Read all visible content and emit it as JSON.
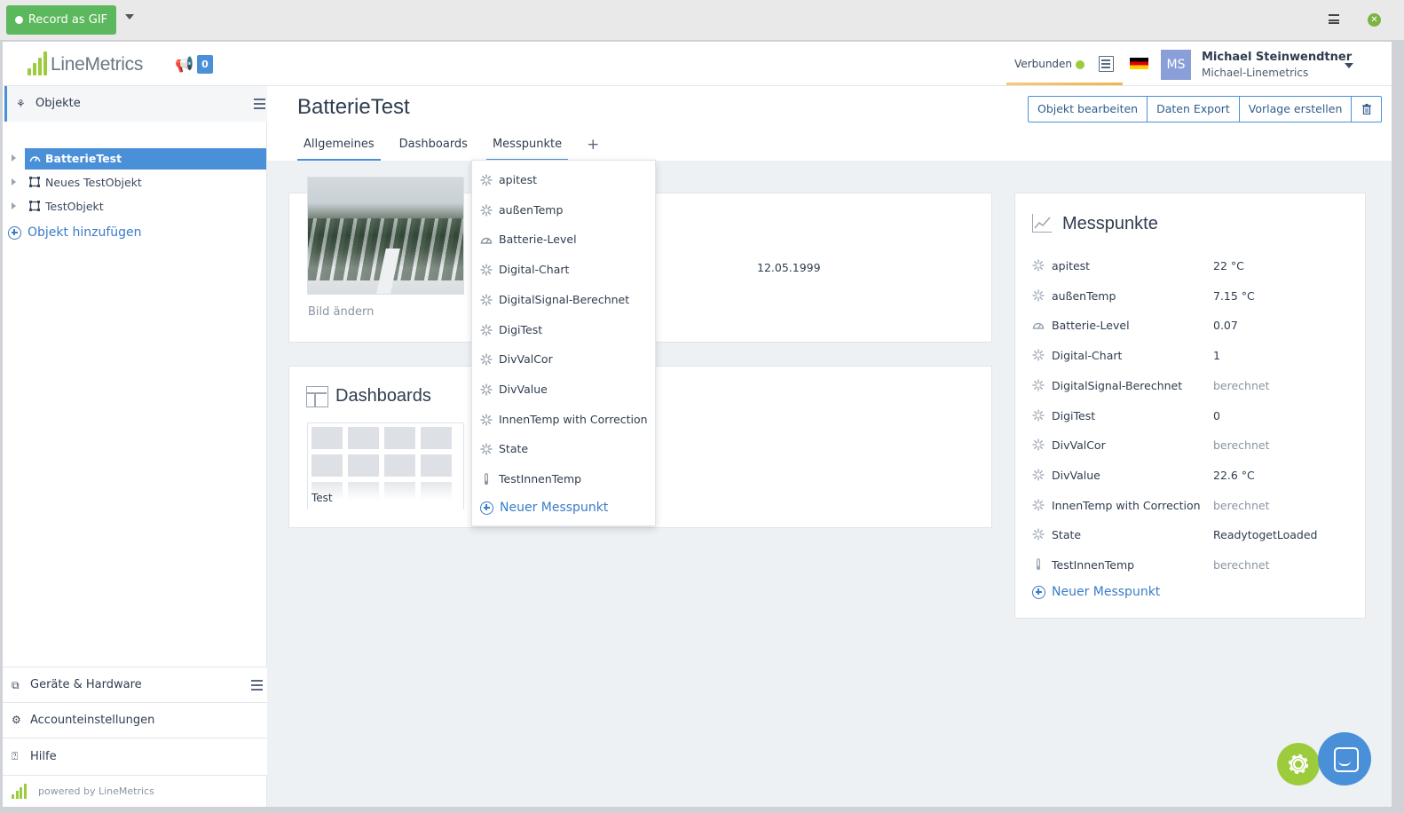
{
  "extension": {
    "record_label": "Record as GIF"
  },
  "header": {
    "logo_text": "LineMetrics",
    "notification_count": "0",
    "connection_status": "Verbunden",
    "connection_color": "#9ccc3c",
    "user_initials": "MS",
    "user_name": "Michael Steinwendtner",
    "user_org": "Michael-Linemetrics"
  },
  "sidebar": {
    "section_title": "Objekte",
    "tree": [
      {
        "label": "BatterieTest",
        "active": true,
        "icon": "gauge-icon"
      },
      {
        "label": "Neues TestObjekt",
        "active": false,
        "icon": "object-icon"
      },
      {
        "label": "TestObjekt",
        "active": false,
        "icon": "object-icon"
      }
    ],
    "add_object": "Objekt hinzufügen",
    "bottom": [
      {
        "label": "Geräte & Hardware",
        "icon": "devices-icon"
      },
      {
        "label": "Accounteinstellungen",
        "icon": "gear-icon"
      },
      {
        "label": "Hilfe",
        "icon": "help-icon"
      }
    ],
    "powered_by": "powered by LineMetrics"
  },
  "object": {
    "title": "BatterieTest",
    "tabs": [
      "Allgemeines",
      "Dashboards",
      "Messpunkte",
      "+"
    ],
    "active_tab": "Messpunkte",
    "actions": [
      "Objekt bearbeiten",
      "Daten Export",
      "Vorlage erstellen"
    ],
    "image_action": "Bild ändern",
    "date": "12.05.1999"
  },
  "dashboards": {
    "title": "Dashboards",
    "items": [
      {
        "label": "Test"
      }
    ]
  },
  "messpunkte": {
    "title": "Messpunkte",
    "items": [
      {
        "name": "apitest",
        "value": "22 °C",
        "muted": false,
        "icon": "spinner-icon"
      },
      {
        "name": "außenTemp",
        "value": "7.15 °C",
        "muted": false,
        "icon": "spinner-icon"
      },
      {
        "name": "Batterie-Level",
        "value": "0.07",
        "muted": false,
        "icon": "gauge-icon"
      },
      {
        "name": "Digital-Chart",
        "value": "1",
        "muted": false,
        "icon": "spinner-icon"
      },
      {
        "name": "DigitalSignal-Berechnet",
        "value": "berechnet",
        "muted": true,
        "icon": "spinner-icon"
      },
      {
        "name": "DigiTest",
        "value": "0",
        "muted": false,
        "icon": "spinner-icon"
      },
      {
        "name": "DivValCor",
        "value": "berechnet",
        "muted": true,
        "icon": "spinner-icon"
      },
      {
        "name": "DivValue",
        "value": "22.6 °C",
        "muted": false,
        "icon": "spinner-icon"
      },
      {
        "name": "InnenTemp with Correction",
        "value": "berechnet",
        "muted": true,
        "icon": "spinner-icon"
      },
      {
        "name": "State",
        "value": "ReadytogetLoaded",
        "muted": false,
        "icon": "spinner-icon"
      },
      {
        "name": "TestInnenTemp",
        "value": "berechnet",
        "muted": true,
        "icon": "thermometer-icon"
      }
    ],
    "new_label": "Neuer Messpunkt"
  },
  "dropdown": {
    "items": [
      {
        "name": "apitest",
        "icon": "spinner-icon"
      },
      {
        "name": "außenTemp",
        "icon": "spinner-icon"
      },
      {
        "name": "Batterie-Level",
        "icon": "gauge-icon"
      },
      {
        "name": "Digital-Chart",
        "icon": "spinner-icon"
      },
      {
        "name": "DigitalSignal-Berechnet",
        "icon": "spinner-icon"
      },
      {
        "name": "DigiTest",
        "icon": "spinner-icon"
      },
      {
        "name": "DivValCor",
        "icon": "spinner-icon"
      },
      {
        "name": "DivValue",
        "icon": "spinner-icon"
      },
      {
        "name": "InnenTemp with Correction",
        "icon": "spinner-icon"
      },
      {
        "name": "State",
        "icon": "spinner-icon"
      },
      {
        "name": "TestInnenTemp",
        "icon": "thermometer-icon"
      }
    ],
    "new_label": "Neuer Messpunkt"
  },
  "colors": {
    "accent": "#4a90d9",
    "brand_green": "#9ccc3c",
    "record_green": "#5cb85c"
  }
}
